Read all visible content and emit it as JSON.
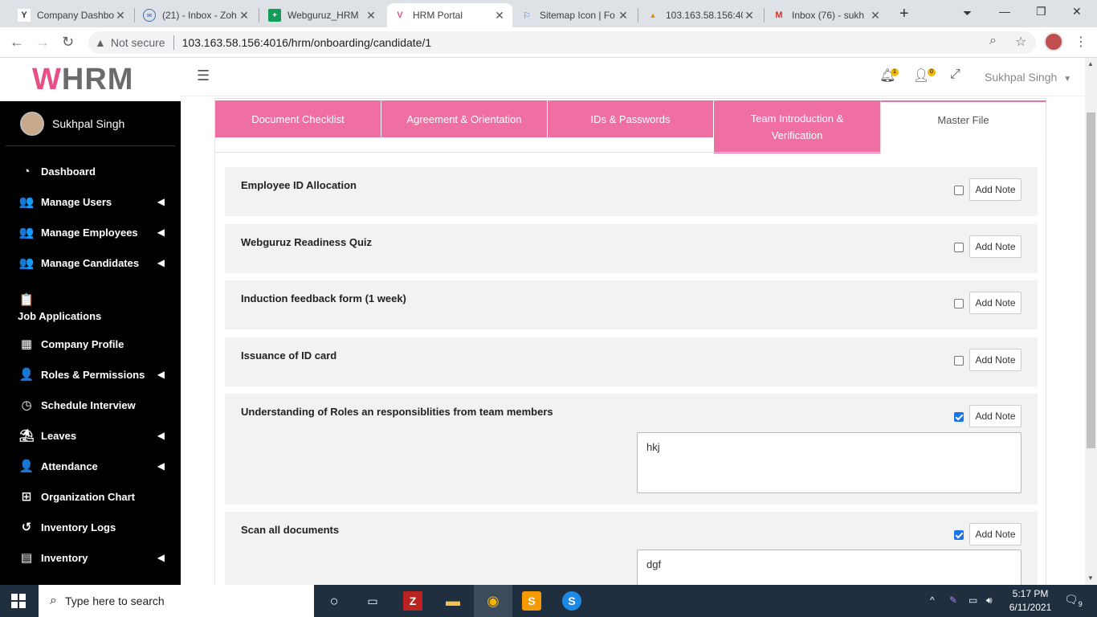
{
  "browser": {
    "tabs": [
      {
        "title": "Company Dashbo",
        "icon": "Y"
      },
      {
        "title": "(21) - Inbox - Zoh",
        "icon": "mail-icon"
      },
      {
        "title": "Webguruz_HRM",
        "icon": "sheets-icon"
      },
      {
        "title": "HRM Portal",
        "icon": "V"
      },
      {
        "title": "Sitemap Icon | Fo",
        "icon": "flag-icon"
      },
      {
        "title": "103.163.58.156:40",
        "icon": "pma-icon"
      },
      {
        "title": "Inbox (76) - sukh",
        "icon": "M"
      }
    ],
    "security_label": "Not secure",
    "url": "103.163.58.156:4016/hrm/onboarding/candidate/1"
  },
  "sidebar": {
    "logo_text": "HRM",
    "user_name": "Sukhpal Singh",
    "items": [
      {
        "label": "Dashboard",
        "icon": "dashboard-icon",
        "glyph": "◔",
        "has_chevron": false
      },
      {
        "label": "Manage Users",
        "icon": "users-icon",
        "glyph": "👥",
        "has_chevron": true
      },
      {
        "label": "Manage Employees",
        "icon": "users-icon",
        "glyph": "👥",
        "has_chevron": true
      },
      {
        "label": "Manage Candidates",
        "icon": "users-icon",
        "glyph": "👥",
        "has_chevron": true
      },
      {
        "label": "Job Applications",
        "icon": "job-applications-icon",
        "glyph": "📋",
        "has_chevron": false
      },
      {
        "label": "Company Profile",
        "icon": "building-icon",
        "glyph": "▦",
        "has_chevron": false
      },
      {
        "label": "Roles & Permissions",
        "icon": "user-lock-icon",
        "glyph": "👤",
        "has_chevron": true
      },
      {
        "label": "Schedule Interview",
        "icon": "clock-icon",
        "glyph": "◷",
        "has_chevron": false
      },
      {
        "label": "Leaves",
        "icon": "umbrella-beach-icon",
        "glyph": "⛱",
        "has_chevron": true
      },
      {
        "label": "Attendance",
        "icon": "user-clock-icon",
        "glyph": "👤",
        "has_chevron": true
      },
      {
        "label": "Organization Chart",
        "icon": "sitemap-icon",
        "glyph": "⊞",
        "has_chevron": false
      },
      {
        "label": "Inventory Logs",
        "icon": "history-icon",
        "glyph": "↺",
        "has_chevron": false
      },
      {
        "label": "Inventory",
        "icon": "inventory-icon",
        "glyph": "▤",
        "has_chevron": true
      }
    ]
  },
  "header": {
    "notification_count": "1",
    "user_requests_count": "0",
    "user_name": "Sukhpal Singh"
  },
  "onboarding": {
    "tabs": [
      {
        "label": "Document Checklist",
        "active": false
      },
      {
        "label": "Agreement & Orientation",
        "active": false
      },
      {
        "label": "IDs & Passwords",
        "active": false
      },
      {
        "label": "Team Introduction & Verification",
        "active": false
      },
      {
        "label": "Master File",
        "active": true
      }
    ],
    "add_note_label": "Add Note",
    "items": [
      {
        "title": "Employee ID Allocation",
        "checked": false,
        "note": null
      },
      {
        "title": "Webguruz Readiness Quiz",
        "checked": false,
        "note": null
      },
      {
        "title": "Induction feedback form (1 week)",
        "checked": false,
        "note": null
      },
      {
        "title": "Issuance of ID card",
        "checked": false,
        "note": null
      },
      {
        "title": "Understanding of Roles an responsiblities from team members",
        "checked": true,
        "note": "hkj"
      },
      {
        "title": "Scan all documents",
        "checked": true,
        "note": "dgf"
      }
    ]
  },
  "taskbar": {
    "search_placeholder": "Type here to search",
    "time": "5:17 PM",
    "date": "6/11/2021",
    "notification_count": "9"
  },
  "colors": {
    "accent_pink": "#f06fa2",
    "sidebar_bg": "#000000",
    "item_bg": "#f2f2f2"
  }
}
